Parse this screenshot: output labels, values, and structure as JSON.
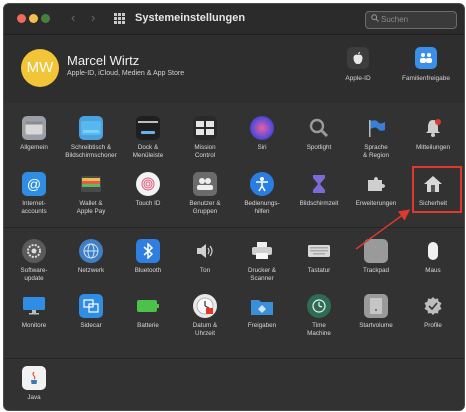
{
  "window": {
    "title": "Systemeinstellungen",
    "search_placeholder": "Suchen"
  },
  "account": {
    "avatar_initials": "MW",
    "name": "Marcel Wirtz",
    "subtitle": "Apple-ID, iCloud, Medien & App Store",
    "items": [
      {
        "label": "Apple-ID",
        "icon": "apple-logo-icon",
        "color": "#3d3d3d"
      },
      {
        "label": "Familienfreigabe",
        "icon": "family-icon",
        "color": "#3a8fe8"
      }
    ]
  },
  "rows": [
    [
      {
        "label": "Allgemein",
        "icon": "general-icon",
        "color": "#9aa0a6"
      },
      {
        "label": "Schreibtisch &\nBildschirmschoner",
        "icon": "desktop-icon",
        "color": "#4aa3df"
      },
      {
        "label": "Dock &\nMenüleiste",
        "icon": "dock-icon",
        "color": "#1f1f1f"
      },
      {
        "label": "Mission\nControl",
        "icon": "mission-control-icon",
        "color": "#2a2a2a"
      },
      {
        "label": "Siri",
        "icon": "siri-icon",
        "color": "#5b4bd6"
      },
      {
        "label": "Spotlight",
        "icon": "spotlight-icon",
        "color": "#5a5a5a"
      },
      {
        "label": "Sprache\n& Region",
        "icon": "flag-icon",
        "color": "#3a7fd6"
      },
      {
        "label": "Mitteilungen",
        "icon": "bell-icon",
        "color": "#c94b3a"
      }
    ],
    [
      {
        "label": "Internet-\naccounts",
        "icon": "at-icon",
        "color": "#2f8ee3"
      },
      {
        "label": "Wallet &\nApple Pay",
        "icon": "wallet-icon",
        "color": "#7c8a6a"
      },
      {
        "label": "Touch ID",
        "icon": "fingerprint-icon",
        "color": "#f3f3f3"
      },
      {
        "label": "Benutzer &\nGruppen",
        "icon": "users-icon",
        "color": "#6b6b6b"
      },
      {
        "label": "Bedienungs-\nhilfen",
        "icon": "accessibility-icon",
        "color": "#2a7de1"
      },
      {
        "label": "Bildschirmzeit",
        "icon": "hourglass-icon",
        "color": "#4a4a8a"
      },
      {
        "label": "Erweiterungen",
        "icon": "puzzle-icon",
        "color": "#8a8a8a"
      },
      {
        "label": "Sicherheit",
        "icon": "house-icon",
        "color": "#8a8a8a"
      }
    ],
    [
      {
        "label": "Software-\nupdate",
        "icon": "gear-icon",
        "color": "#5a5a5a"
      },
      {
        "label": "Netzwerk",
        "icon": "globe-icon",
        "color": "#3f7fc4"
      },
      {
        "label": "Bluetooth",
        "icon": "bluetooth-icon",
        "color": "#2f7fe0"
      },
      {
        "label": "Ton",
        "icon": "speaker-icon",
        "color": "#4a4a4a"
      },
      {
        "label": "Drucker &\nScanner",
        "icon": "printer-icon",
        "color": "#cfcfcf"
      },
      {
        "label": "Tastatur",
        "icon": "keyboard-icon",
        "color": "#cdcdcd"
      },
      {
        "label": "Trackpad",
        "icon": "trackpad-icon",
        "color": "#9a9a9a"
      },
      {
        "label": "Maus",
        "icon": "mouse-icon",
        "color": "#f0f0f0"
      }
    ],
    [
      {
        "label": "Monitore",
        "icon": "monitor-icon",
        "color": "#2f8ee3"
      },
      {
        "label": "Sidecar",
        "icon": "sidecar-icon",
        "color": "#2f8ee3"
      },
      {
        "label": "Batterie",
        "icon": "battery-icon",
        "color": "#4cc24a"
      },
      {
        "label": "Datum &\nUhrzeit",
        "icon": "clock-icon",
        "color": "#e9e9e9"
      },
      {
        "label": "Freigaben",
        "icon": "folder-icon",
        "color": "#3b8fd9"
      },
      {
        "label": "Time\nMachine",
        "icon": "time-machine-icon",
        "color": "#2f6b55"
      },
      {
        "label": "Startvolume",
        "icon": "disk-icon",
        "color": "#9a9a9a"
      },
      {
        "label": "Profile",
        "icon": "checkmark-badge-icon",
        "color": "#8a8a8a"
      }
    ],
    [
      {
        "label": "Java",
        "icon": "java-icon",
        "color": "#f2f2f2"
      }
    ]
  ],
  "annotation": {
    "highlight_color": "#e0392b"
  }
}
